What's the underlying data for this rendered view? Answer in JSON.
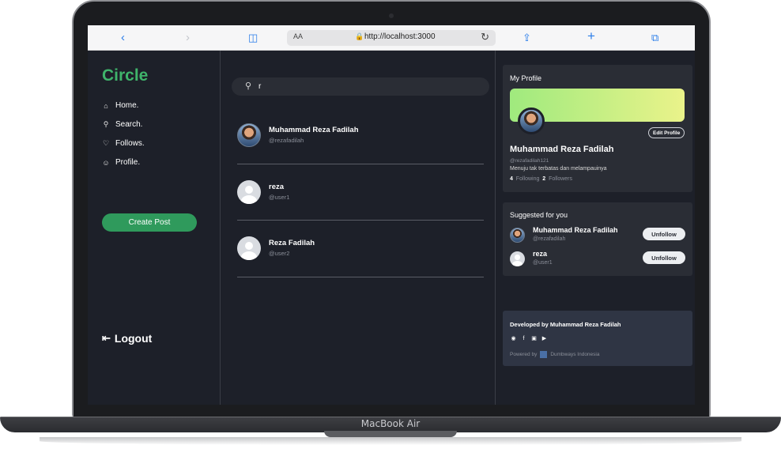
{
  "device": {
    "model_label": "MacBook Air"
  },
  "browser": {
    "reader_label": "AA",
    "url": "http://localhost:3000"
  },
  "sidebar": {
    "logo": "Circle",
    "nav": [
      {
        "label": "Home.",
        "icon": "home-icon"
      },
      {
        "label": "Search.",
        "icon": "search-icon"
      },
      {
        "label": "Follows.",
        "icon": "heart-icon"
      },
      {
        "label": "Profile.",
        "icon": "user-circle-icon"
      }
    ],
    "create_post": "Create Post",
    "logout": "Logout"
  },
  "search": {
    "value": "r",
    "results": [
      {
        "name": "Muhammad Reza Fadilah",
        "username": "@rezafadilah",
        "avatar": "photo"
      },
      {
        "name": "reza",
        "username": "@user1",
        "avatar": "default"
      },
      {
        "name": "Reza Fadilah",
        "username": "@user2",
        "avatar": "default"
      }
    ]
  },
  "profile": {
    "title": "My Profile",
    "edit_label": "Edit Profile",
    "name": "Muhammad Reza Fadilah",
    "username": "@rezafadilah121",
    "bio": "Menuju tak terbatas dan melampauinya",
    "following_count": "4",
    "following_label": "Following",
    "followers_count": "2",
    "followers_label": "Followers"
  },
  "suggested": {
    "title": "Suggested for you",
    "users": [
      {
        "name": "Muhammad Reza Fadilah",
        "username": "@rezafadilah",
        "button": "Unfollow",
        "avatar": "photo"
      },
      {
        "name": "reza",
        "username": "@user1",
        "button": "Unfollow",
        "avatar": "default"
      }
    ]
  },
  "footer": {
    "developed_by": "Developed by Muhammad Reza Fadilah",
    "socials": [
      "github-icon",
      "facebook-icon",
      "instagram-icon",
      "youtube-icon"
    ],
    "powered_by": "Powered by",
    "powered_brand": "Dumbways Indonesia"
  },
  "colors": {
    "accent": "#3fb46b",
    "button_green": "#2f9a5c",
    "background": "#1d2029",
    "card": "#2a2d35"
  }
}
